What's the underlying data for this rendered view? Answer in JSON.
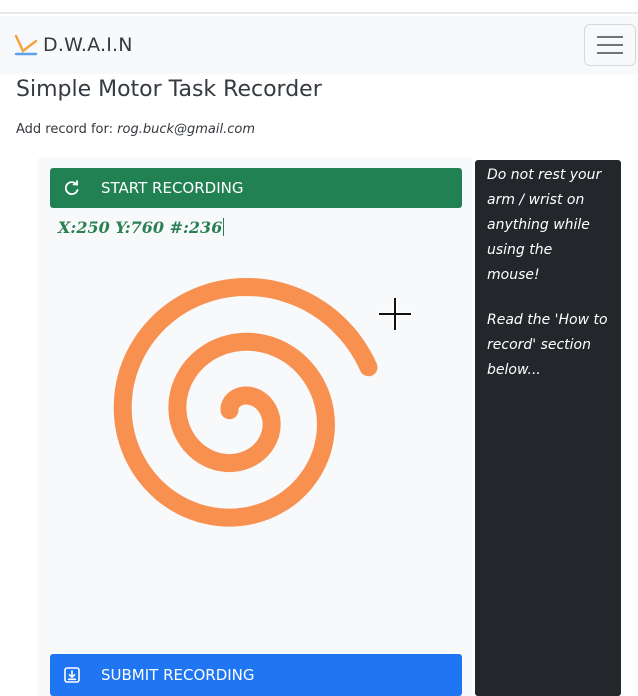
{
  "navbar": {
    "brand": "D.W.A.I.N",
    "logo_icon": "check-logo-icon",
    "menu_icon": "hamburger-icon"
  },
  "page": {
    "title": "Simple Motor Task Recorder",
    "subtitle_prefix": "Add record for:",
    "subtitle_email": "rog.buck@gmail.com"
  },
  "recorder": {
    "start_label": "START RECORDING",
    "start_icon": "refresh-icon",
    "coords_text": "X:250 Y:760 #:236",
    "submit_label": "SUBMIT RECORDING",
    "submit_icon": "download-icon",
    "spiral_color": "#f89050",
    "start_color": "#218153",
    "submit_color": "#1f75f2"
  },
  "info": {
    "line1": "Do not rest your arm / wrist on anything while using the mouse!",
    "line2": "Read the 'How to record' section below..."
  }
}
